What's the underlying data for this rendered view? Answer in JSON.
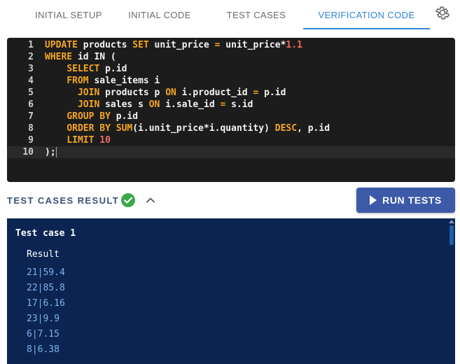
{
  "tabs": [
    {
      "label": "INITIAL SETUP"
    },
    {
      "label": "INITIAL CODE"
    },
    {
      "label": "TEST CASES"
    },
    {
      "label": "VERIFICATION CODE"
    }
  ],
  "active_tab": "VERIFICATION CODE",
  "icons": {
    "settings": "gear-icon",
    "status": "check-circle-icon",
    "collapse": "chevron-up-icon",
    "run": "play-icon"
  },
  "colors": {
    "accent": "#2f84d6",
    "success": "#3aa84a",
    "run_button": "#3c5aa8",
    "output_bg": "#0b2452",
    "keyword": "#f5a623",
    "number": "#f06d5d"
  },
  "editor": {
    "lines": [
      {
        "n": "1",
        "tokens": [
          {
            "t": "UPDATE",
            "c": "kw"
          },
          {
            "t": " products ",
            "c": ""
          },
          {
            "t": "SET",
            "c": "kw"
          },
          {
            "t": " unit_price ",
            "c": ""
          },
          {
            "t": "=",
            "c": "kw"
          },
          {
            "t": " unit_price*",
            "c": ""
          },
          {
            "t": "1.1",
            "c": "num"
          }
        ]
      },
      {
        "n": "2",
        "tokens": [
          {
            "t": "WHERE",
            "c": "kw"
          },
          {
            "t": " id IN (",
            "c": ""
          }
        ]
      },
      {
        "n": "3",
        "tokens": [
          {
            "t": "    ",
            "c": ""
          },
          {
            "t": "SELECT",
            "c": "kw"
          },
          {
            "t": " p.id",
            "c": ""
          }
        ]
      },
      {
        "n": "4",
        "tokens": [
          {
            "t": "    ",
            "c": ""
          },
          {
            "t": "FROM",
            "c": "kw"
          },
          {
            "t": " sale_items i",
            "c": ""
          }
        ]
      },
      {
        "n": "5",
        "tokens": [
          {
            "t": "      ",
            "c": ""
          },
          {
            "t": "JOIN",
            "c": "kw"
          },
          {
            "t": " products p ",
            "c": ""
          },
          {
            "t": "ON",
            "c": "kw"
          },
          {
            "t": " i.product_id ",
            "c": ""
          },
          {
            "t": "=",
            "c": "kw"
          },
          {
            "t": " p.id",
            "c": ""
          }
        ]
      },
      {
        "n": "6",
        "tokens": [
          {
            "t": "      ",
            "c": ""
          },
          {
            "t": "JOIN",
            "c": "kw"
          },
          {
            "t": " sales s ",
            "c": ""
          },
          {
            "t": "ON",
            "c": "kw"
          },
          {
            "t": " i.sale_id ",
            "c": ""
          },
          {
            "t": "=",
            "c": "kw"
          },
          {
            "t": " s.id",
            "c": ""
          }
        ]
      },
      {
        "n": "7",
        "tokens": [
          {
            "t": "    ",
            "c": ""
          },
          {
            "t": "GROUP BY",
            "c": "kw"
          },
          {
            "t": " p.id",
            "c": ""
          }
        ]
      },
      {
        "n": "8",
        "tokens": [
          {
            "t": "    ",
            "c": ""
          },
          {
            "t": "ORDER BY",
            "c": "kw"
          },
          {
            "t": " ",
            "c": ""
          },
          {
            "t": "SUM",
            "c": "kw"
          },
          {
            "t": "(i.unit_price*i.quantity) ",
            "c": ""
          },
          {
            "t": "DESC",
            "c": "kw"
          },
          {
            "t": ", p.id",
            "c": ""
          }
        ]
      },
      {
        "n": "9",
        "tokens": [
          {
            "t": "    ",
            "c": ""
          },
          {
            "t": "LIMIT",
            "c": "kw"
          },
          {
            "t": " ",
            "c": ""
          },
          {
            "t": "10",
            "c": "num"
          }
        ]
      },
      {
        "n": "10",
        "tokens": [
          {
            "t": ");",
            "c": ""
          }
        ]
      }
    ],
    "active_line": "10"
  },
  "results": {
    "title": "TEST CASES RESULT",
    "run_label": "RUN TESTS",
    "test_case_label": "Test case 1",
    "result_label": "Result",
    "rows": [
      "21|59.4",
      "22|85.8",
      "17|6.16",
      "23|9.9",
      "6|7.15",
      "8|6.38"
    ]
  }
}
